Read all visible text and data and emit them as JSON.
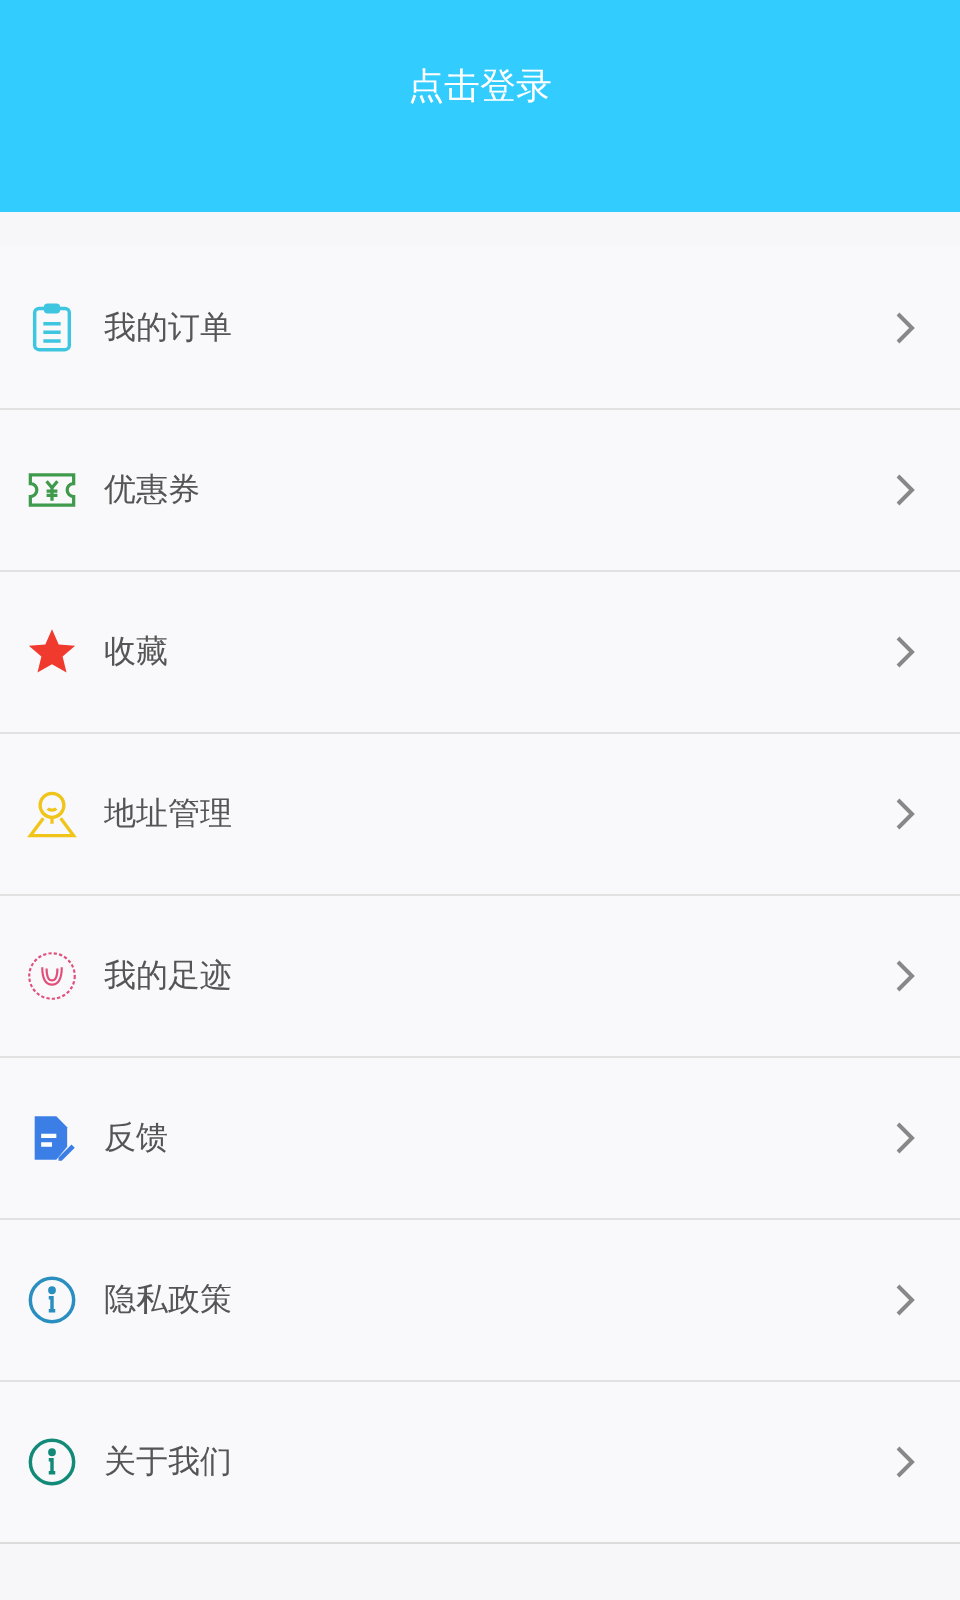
{
  "header": {
    "title": "点击登录"
  },
  "menu": [
    {
      "label": "我的订单",
      "kind": "clipboard",
      "color": "#3ec6e0"
    },
    {
      "label": "优惠券",
      "kind": "ticket",
      "color": "#3f9a4c"
    },
    {
      "label": "收藏",
      "kind": "star",
      "color": "#f03a2e"
    },
    {
      "label": "地址管理",
      "kind": "location",
      "color": "#f0c419"
    },
    {
      "label": "我的足迹",
      "kind": "footprint",
      "color": "#e0507a"
    },
    {
      "label": "反馈",
      "kind": "feedback",
      "color": "#3b7fe6"
    },
    {
      "label": "隐私政策",
      "kind": "info",
      "color": "#2a8fc0"
    },
    {
      "label": "关于我们",
      "kind": "info",
      "color": "#138a78"
    }
  ]
}
